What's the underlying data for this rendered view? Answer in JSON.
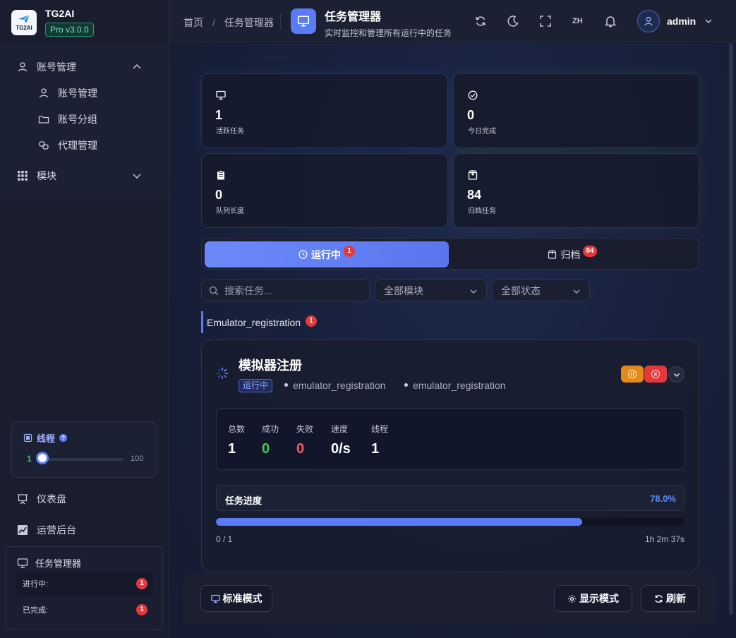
{
  "brand": {
    "name": "TG2AI",
    "logo_text": "TG2AI",
    "version": "Pro v3.0.0"
  },
  "sidebar": {
    "account_group": {
      "label": "账号管理",
      "items": [
        {
          "label": "账号管理"
        },
        {
          "label": "账号分组"
        },
        {
          "label": "代理管理"
        }
      ]
    },
    "modules_label": "模块",
    "thread": {
      "label": "线程",
      "help": "?",
      "value": "1",
      "max": "100"
    },
    "links": {
      "dashboard": "仪表盘",
      "operations": "运营后台"
    },
    "task_manager": {
      "title": "任务管理器",
      "running_label": "进行中:",
      "running_count": "1",
      "done_label": "已完成:",
      "done_count": "1"
    }
  },
  "header": {
    "breadcrumb": {
      "home": "首页",
      "sep": "/",
      "current": "任务管理器"
    },
    "title": "任务管理器",
    "subtitle": "实时监控和管理所有运行中的任务",
    "lang": "ZH",
    "user": "admin"
  },
  "stats": [
    {
      "value": "1",
      "label": "活跃任务"
    },
    {
      "value": "0",
      "label": "今日完成"
    },
    {
      "value": "0",
      "label": "队列长度"
    },
    {
      "value": "84",
      "label": "归档任务"
    }
  ],
  "tabs": [
    {
      "label": "运行中",
      "badge": "1"
    },
    {
      "label": "归档",
      "badge": "84"
    }
  ],
  "filters": {
    "search_placeholder": "搜索任务...",
    "module": "全部模块",
    "status": "全部状态"
  },
  "group": {
    "name": "Emulator_registration",
    "count": "1"
  },
  "task": {
    "title": "模拟器注册",
    "status": "运行中",
    "meta": [
      "emulator_registration",
      "emulator_registration"
    ],
    "metrics": [
      {
        "label": "总数",
        "value": "1",
        "color": "#ffffff"
      },
      {
        "label": "成功",
        "value": "0",
        "color": "#4cc75a"
      },
      {
        "label": "失败",
        "value": "0",
        "color": "#ee5d62"
      },
      {
        "label": "速度",
        "value": "0/s",
        "color": "#ffffff"
      },
      {
        "label": "线程",
        "value": "1",
        "color": "#ffffff"
      }
    ],
    "progress": {
      "label": "任务进度",
      "percent_text": "78.0%",
      "percent": 78,
      "count": "0 / 1",
      "elapsed": "1h 2m 37s"
    }
  },
  "footer": {
    "standard_mode": "标准模式",
    "display_mode": "显示模式",
    "refresh": "刷新"
  },
  "colors": {
    "accent": "#5c7af5",
    "danger": "#e5383b",
    "warning": "#e38b1a",
    "success": "#3ec46d"
  }
}
